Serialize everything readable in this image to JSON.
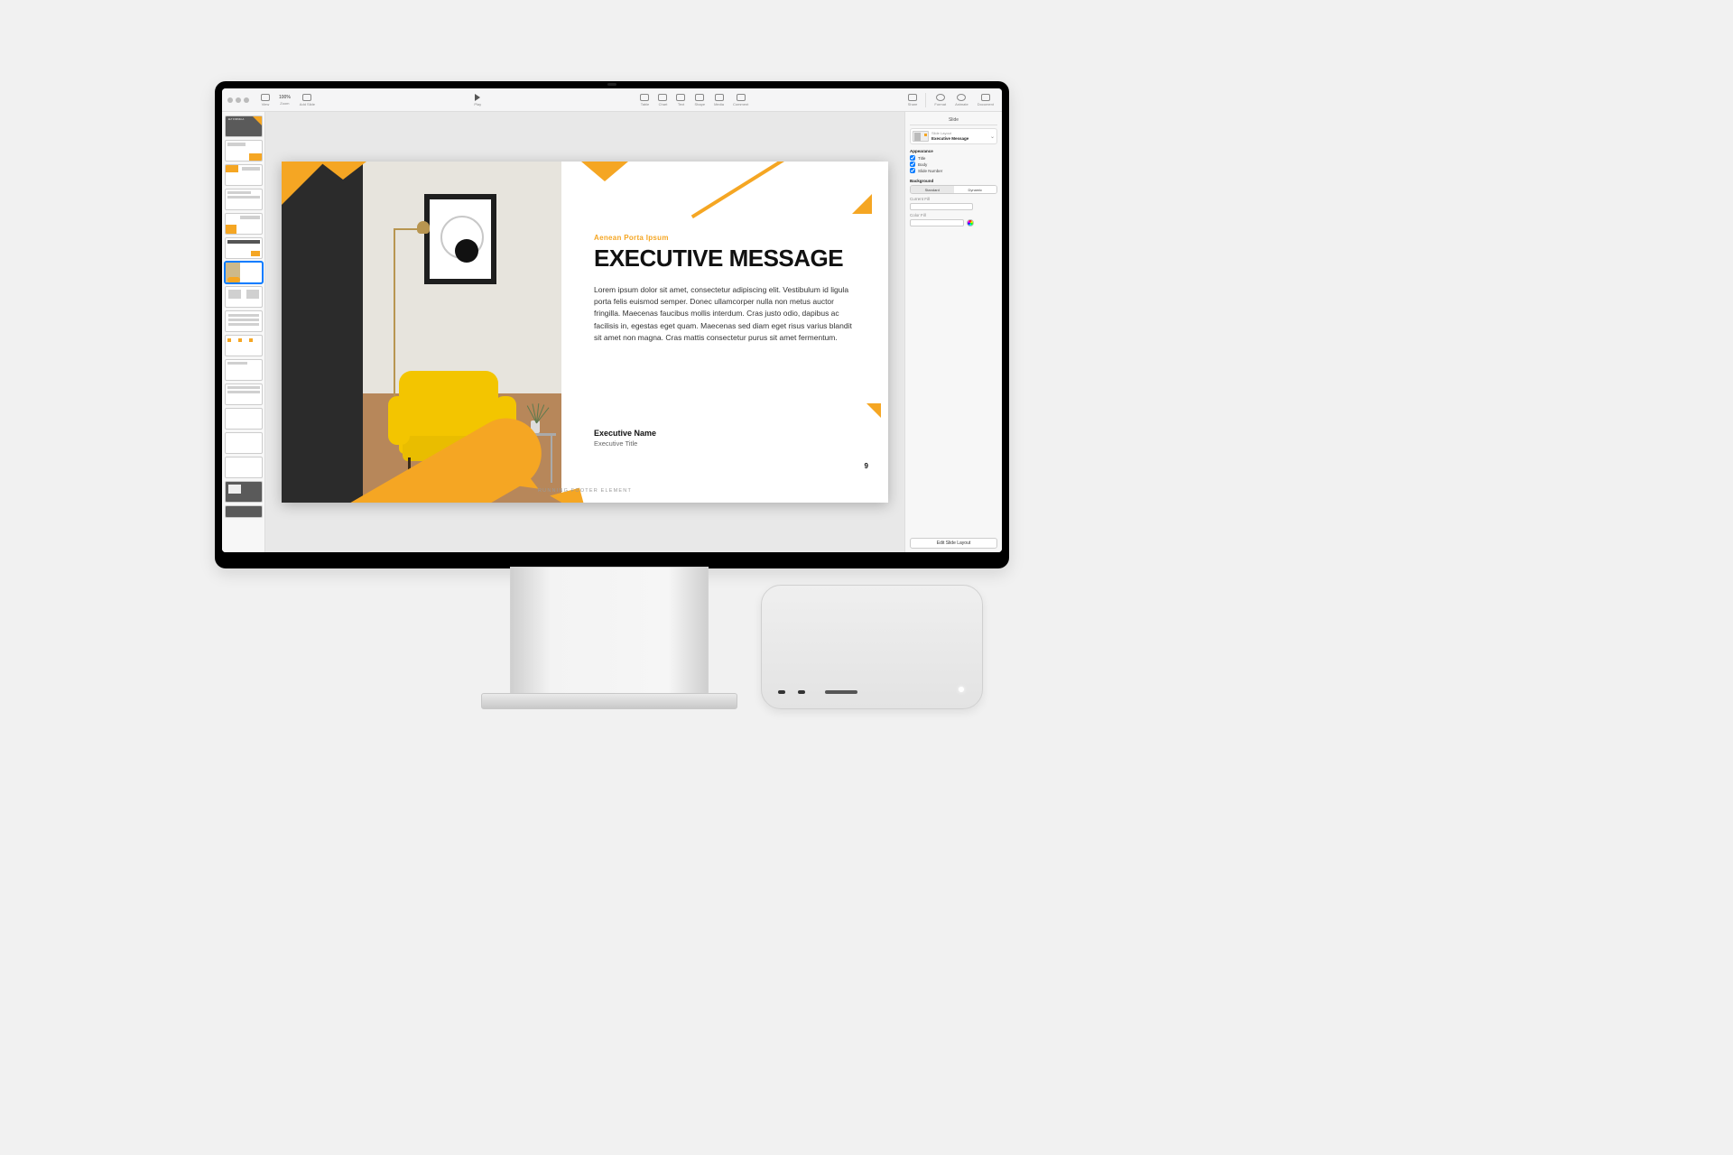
{
  "toolbar": {
    "view": "View",
    "zoom_value": "100%",
    "zoom": "Zoom",
    "add_slide": "Add Slide",
    "play": "Play",
    "table": "Table",
    "chart": "Chart",
    "text": "Text",
    "shape": "Shape",
    "media": "Media",
    "comment": "Comment",
    "share": "Share",
    "format": "Format",
    "animate": "Animate",
    "document": "Document"
  },
  "inspector": {
    "tab": "Slide",
    "layout_caption": "Slide Layout",
    "layout_name": "Executive Message",
    "appearance": "Appearance",
    "chk_title": "Title",
    "chk_body": "Body",
    "chk_slidenum": "Slide Number",
    "background": "Background",
    "seg_standard": "Standard",
    "seg_dynamic": "Dynamic",
    "current_fill": "Current Fill",
    "color_fill": "Color Fill",
    "edit_layout": "Edit Slide Layout"
  },
  "slide": {
    "kicker": "Aenean Porta Ipsum",
    "title": "EXECUTIVE MESSAGE",
    "body": "Lorem ipsum dolor sit amet, consectetur adipiscing elit. Vestibulum id ligula porta felis euismod semper. Donec ullamcorper nulla non metus auctor fringilla. Maecenas faucibus mollis interdum. Cras justo odio, dapibus ac facilisis in, egestas eget quam. Maecenas sed diam eget risus varius blandit sit amet non magna. Cras mattis consectetur purus sit amet fermentum.",
    "sig_name": "Executive Name",
    "sig_title": "Executive Title",
    "footer": "RUNNING FOOTER ELEMENT",
    "page": "9"
  },
  "thumbs": {
    "t1": "ELT FORMULA"
  }
}
